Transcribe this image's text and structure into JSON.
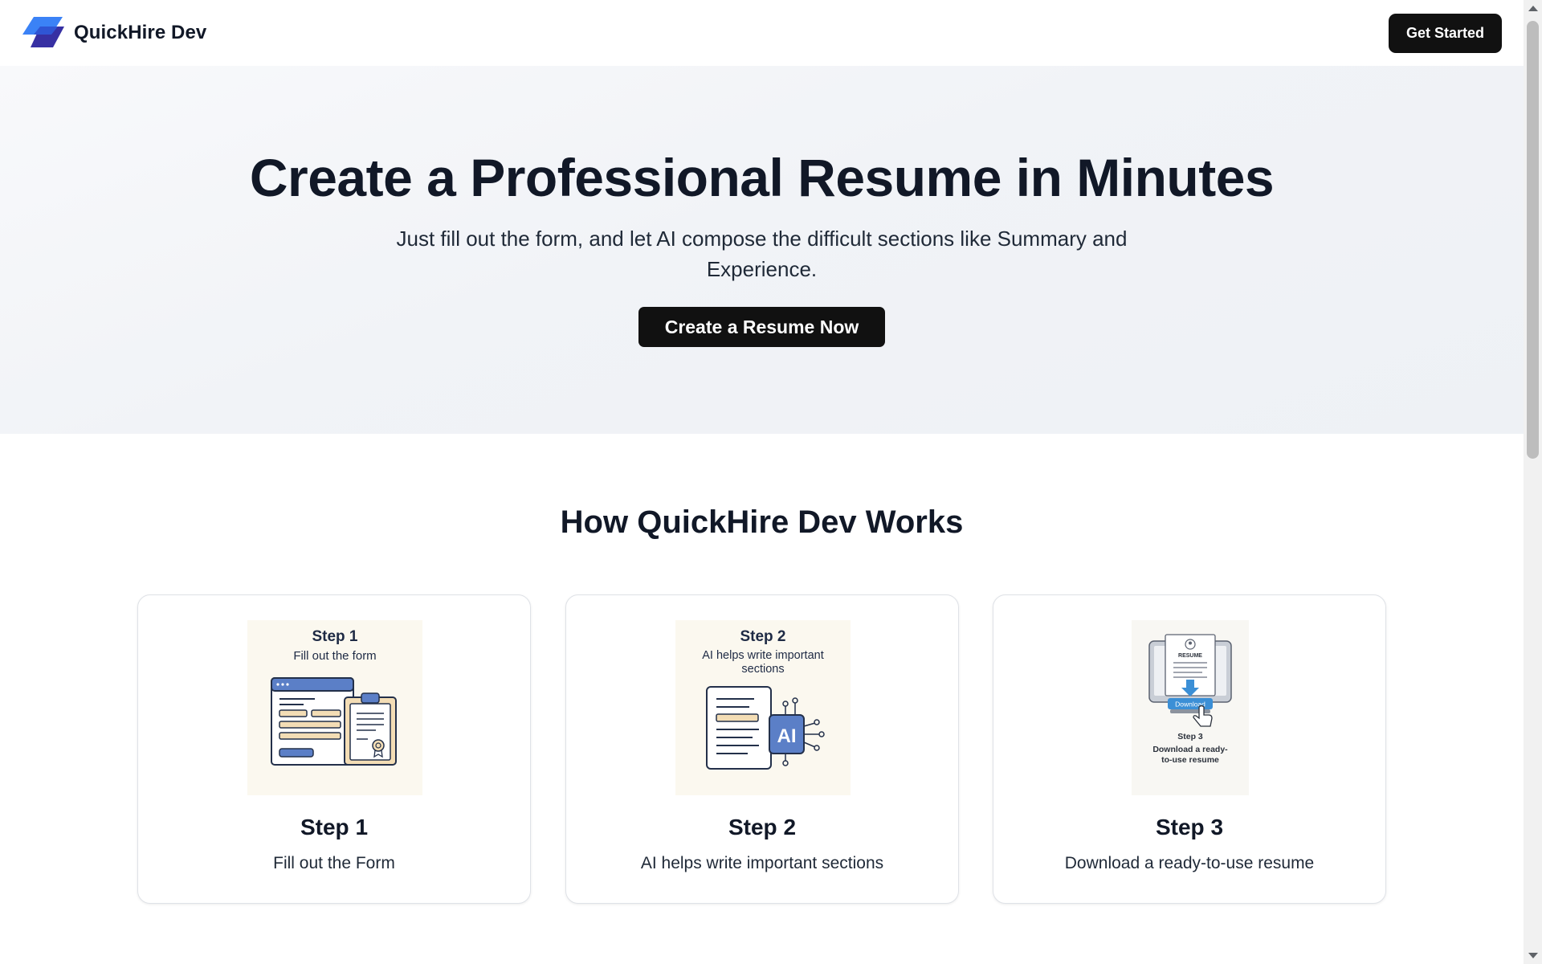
{
  "header": {
    "brand_name": "QuickHire Dev",
    "logo_icon": "stacked-parallelogram-logo",
    "cta_label": "Get Started"
  },
  "hero": {
    "title": "Create a Professional Resume in Minutes",
    "subtitle": "Just fill out the form, and let AI compose the difficult sections like Summary and Experience.",
    "cta_label": "Create a Resume Now"
  },
  "how_it_works": {
    "title": "How QuickHire Dev Works",
    "steps": [
      {
        "title": "Step 1",
        "description": "Fill out the Form",
        "image_heading": "Step 1",
        "image_caption": "Fill out the form",
        "icon": "form-clipboard-icon"
      },
      {
        "title": "Step 2",
        "description": "AI helps write important sections",
        "image_heading": "Step 2",
        "image_caption_line1": "AI helps write important",
        "image_caption_line2": "sections",
        "chip_label": "AI",
        "icon": "document-ai-chip-icon"
      },
      {
        "title": "Step 3",
        "description": "Download a ready-to-use resume",
        "image_doc_label": "RESUME",
        "image_button_label": "Download",
        "image_heading": "Step 3",
        "image_caption_line1": "Download a ready-",
        "image_caption_line2": "to-use resume",
        "icon": "monitor-download-icon"
      }
    ]
  },
  "colors": {
    "primary_button": "#111111",
    "logo_light": "#3b82f6",
    "logo_dark": "#3730a3",
    "illustration_blue": "#5b7fc7",
    "illustration_beige": "#f3ddb5"
  }
}
